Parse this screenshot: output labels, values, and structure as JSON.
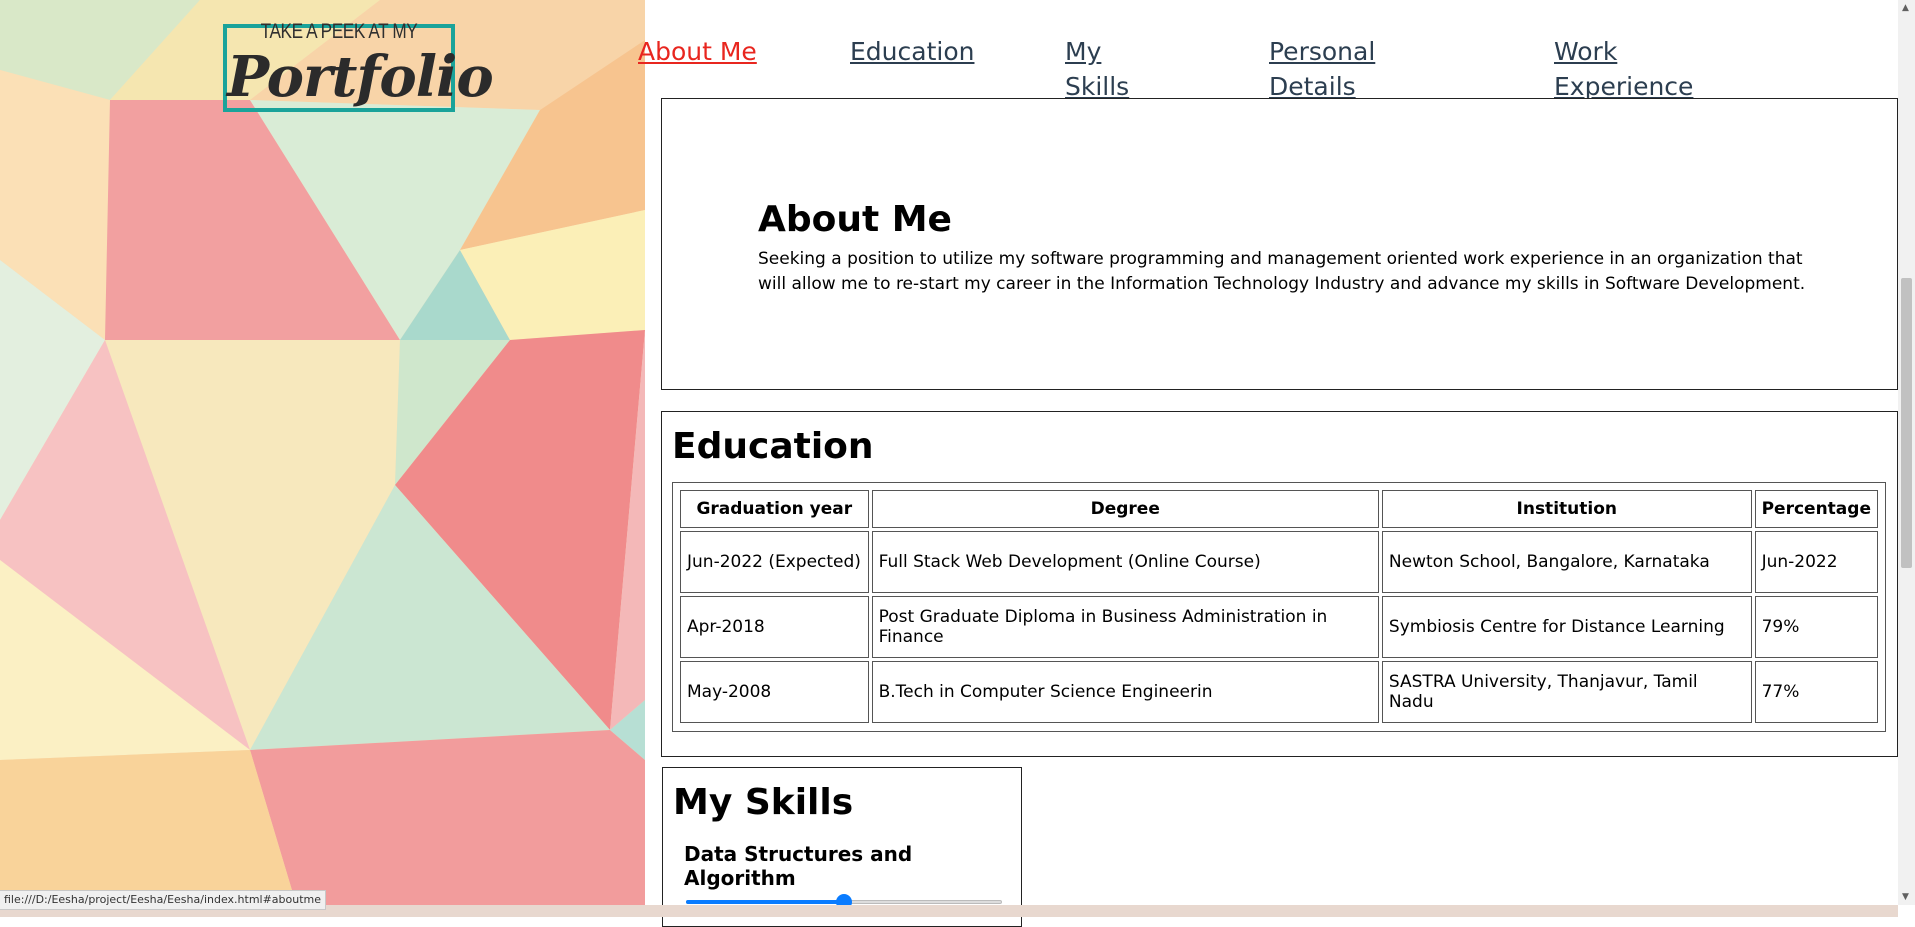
{
  "logo": {
    "tagline": "TAKE A PEEK AT MY",
    "mark": "Portfolio"
  },
  "nav": {
    "items": [
      {
        "label": "About Me",
        "active": true
      },
      {
        "label": "Education",
        "active": false
      },
      {
        "label": "My Skills",
        "active": false
      },
      {
        "label": "Personal Details",
        "active": false
      },
      {
        "label": "Work Experience",
        "active": false
      }
    ]
  },
  "about": {
    "title": "About Me",
    "text": "Seeking a position to utilize my software programming and management oriented work experience in an organization that will allow me to re-start my career in the Information Technology Industry and advance my skills in Software Development."
  },
  "education": {
    "title": "Education",
    "headers": [
      "Graduation year",
      "Degree",
      "Institution",
      "Percentage"
    ],
    "rows": [
      [
        "Jun-2022 (Expected)",
        "Full Stack Web Development (Online Course)",
        "Newton School, Bangalore, Karnataka",
        "Jun-2022"
      ],
      [
        "Apr-2018",
        "Post Graduate Diploma in Business Administration in Finance",
        "Symbiosis Centre for Distance Learning",
        "79%"
      ],
      [
        "May-2008",
        "B.Tech in Computer Science Engineerin",
        "SASTRA University, Thanjavur, Tamil Nadu",
        "77%"
      ]
    ]
  },
  "skills": {
    "title": "My Skills",
    "items": [
      {
        "name": "Data Structures and Algorithm",
        "level": 0.5
      }
    ]
  },
  "status_bar": {
    "url": "file:///D:/Eesha/project/Eesha/Eesha/index.html#aboutme"
  },
  "colors": {
    "active_link": "#e8261f",
    "nav_link": "#2c3e50",
    "logo_border": "#1aa39a",
    "slider": "#0a7cff"
  }
}
